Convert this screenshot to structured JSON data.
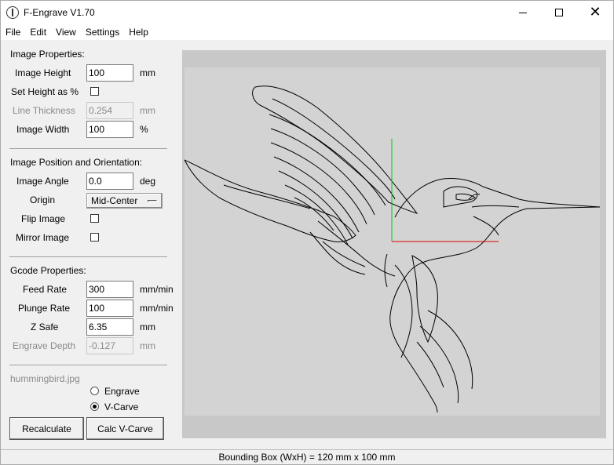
{
  "window": {
    "title": "F-Engrave V1.70"
  },
  "menu": [
    "File",
    "Edit",
    "View",
    "Settings",
    "Help"
  ],
  "image_properties": {
    "section_title": "Image Properties:",
    "image_height": {
      "label": "Image Height",
      "value": "100",
      "unit": "mm"
    },
    "set_height_pct": {
      "label": "Set Height as %",
      "checked": false
    },
    "line_thickness": {
      "label": "Line Thickness",
      "value": "0.254",
      "unit": "mm",
      "disabled": true
    },
    "image_width": {
      "label": "Image Width",
      "value": "100",
      "unit": "%"
    }
  },
  "position_orientation": {
    "section_title": "Image Position and Orientation:",
    "image_angle": {
      "label": "Image Angle",
      "value": "0.0",
      "unit": "deg"
    },
    "origin": {
      "label": "Origin",
      "value": "Mid-Center"
    },
    "flip_image": {
      "label": "Flip Image",
      "checked": false
    },
    "mirror_image": {
      "label": "Mirror Image",
      "checked": false
    }
  },
  "gcode": {
    "section_title": "Gcode Properties:",
    "feed_rate": {
      "label": "Feed Rate",
      "value": "300",
      "unit": "mm/min"
    },
    "plunge_rate": {
      "label": "Plunge Rate",
      "value": "100",
      "unit": "mm/min"
    },
    "z_safe": {
      "label": "Z Safe",
      "value": "6.35",
      "unit": "mm"
    },
    "engrave_depth": {
      "label": "Engrave Depth",
      "value": "-0.127",
      "unit": "mm",
      "disabled": true
    }
  },
  "file": {
    "name": "hummingbird.jpg"
  },
  "mode": {
    "options": [
      "Engrave",
      "V-Carve"
    ],
    "selected": "V-Carve"
  },
  "buttons": {
    "recalculate": "Recalculate",
    "calc_vcarve": "Calc V-Carve"
  },
  "status": {
    "text": "Bounding Box (WxH) = 120 mm  x 100 mm"
  },
  "colors": {
    "axis_x": "#e00000",
    "axis_y": "#00cc00",
    "canvas_bg": "#d3d3d3",
    "canvas_border": "#c8c8c8"
  }
}
